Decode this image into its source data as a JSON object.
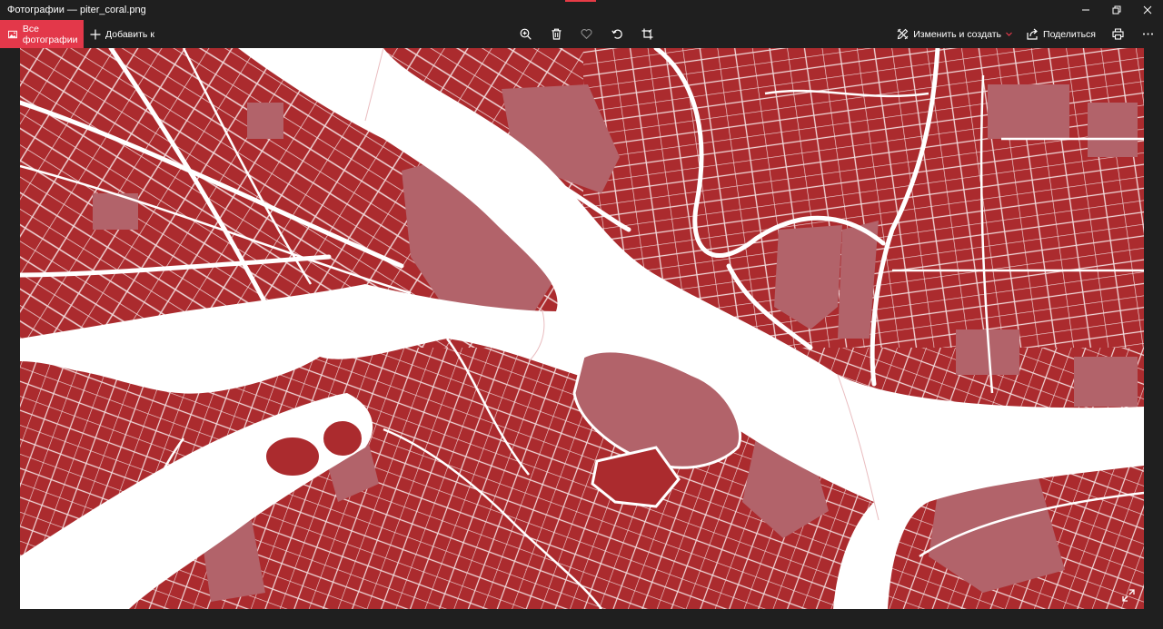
{
  "window": {
    "title": "Фотографии — piter_coral.png"
  },
  "toolbar": {
    "all_photos_label": "Все фотографии",
    "add_label": "Добавить к",
    "edit_create_label": "Изменить и создать",
    "share_label": "Поделиться"
  },
  "icons": {
    "all_photos": "photos-icon",
    "add": "plus-icon",
    "zoom": "zoom-icon",
    "delete": "trash-icon",
    "favorite": "heart-icon",
    "rotate": "rotate-icon",
    "crop": "crop-icon",
    "edit": "edit-create-icon",
    "share": "share-icon",
    "print": "print-icon",
    "more": "more-icon",
    "expand": "expand-icon"
  },
  "colors": {
    "accent": "#e3384a",
    "map_land": "#ab2b2e",
    "map_block": "#b2636a",
    "map_water": "#ffffff",
    "background": "#1f1f1f"
  }
}
